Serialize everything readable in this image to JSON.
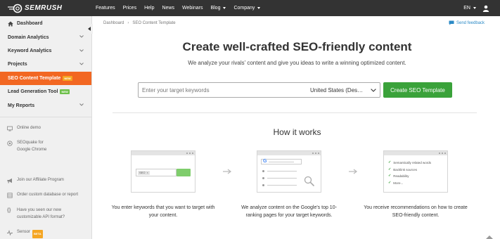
{
  "topbar": {
    "logo_text": "SEMRUSH",
    "nav": [
      {
        "label": "Features",
        "dropdown": false
      },
      {
        "label": "Prices",
        "dropdown": false
      },
      {
        "label": "Help",
        "dropdown": false
      },
      {
        "label": "News",
        "dropdown": false
      },
      {
        "label": "Webinars",
        "dropdown": false
      },
      {
        "label": "Blog",
        "dropdown": true
      },
      {
        "label": "Company",
        "dropdown": true
      }
    ],
    "language": "EN"
  },
  "sidebar": {
    "items": [
      {
        "label": "Dashboard",
        "icon": "home-icon"
      },
      {
        "label": "Domain Analytics",
        "icon": "chevron-down-icon"
      },
      {
        "label": "Keyword Analytics",
        "icon": "chevron-down-icon"
      },
      {
        "label": "Projects",
        "icon": "chevron-down-icon"
      },
      {
        "label": "SEO Content Template",
        "badge": "NEW",
        "active": true
      },
      {
        "label": "Lead Generation Tool",
        "badge": "NEW"
      },
      {
        "label": "My Reports",
        "icon": "chevron-down-icon"
      }
    ],
    "tools": [
      {
        "label": "Online demo",
        "icon": "monitor-icon"
      },
      {
        "line1": "SEOquake for",
        "line2": "Google Chrome",
        "icon": "seoquake-icon"
      },
      {
        "label": "Join our Affiliate Program",
        "icon": "megaphone-icon"
      },
      {
        "label": "Order custom database or report",
        "icon": "database-icon"
      },
      {
        "line1": "Have you seen our new",
        "line2": "customizable API format?",
        "icon": "braces-icon"
      },
      {
        "label": "Sensor",
        "badge": "BETA",
        "icon": "pulse-icon"
      }
    ]
  },
  "breadcrumb": {
    "root": "Dashboard",
    "current": "SEO Content Template"
  },
  "feedback": {
    "label": "Send feedback"
  },
  "hero": {
    "title": "Create well-crafted SEO-friendly content",
    "subtitle": "We analyze your rivals’ content and give you ideas to write a winning optimized content."
  },
  "form": {
    "keyword_placeholder": "Enter your target keywords",
    "keyword_value": "",
    "country": "United States (Des…",
    "button": "Create SEO Template"
  },
  "how": {
    "title": "How it works",
    "card1": {
      "chip": "SEO"
    },
    "card3": {
      "items": [
        "Semantically related words",
        "Backlink sources",
        "Readability",
        "More..."
      ]
    },
    "captions": [
      {
        "line1": "You enter keywords that you want to target with",
        "line2": "your content."
      },
      {
        "line1": "We analyze content on the Google's top 10-",
        "line2": "ranking pages for your target keywords."
      },
      {
        "line1": "You receive recommendations on how to create",
        "line2": "SEO-friendly content."
      }
    ]
  },
  "colors": {
    "accent": "#f26722",
    "cta": "#3aa23a",
    "topbar": "#333333",
    "link": "#2b8ac6"
  }
}
